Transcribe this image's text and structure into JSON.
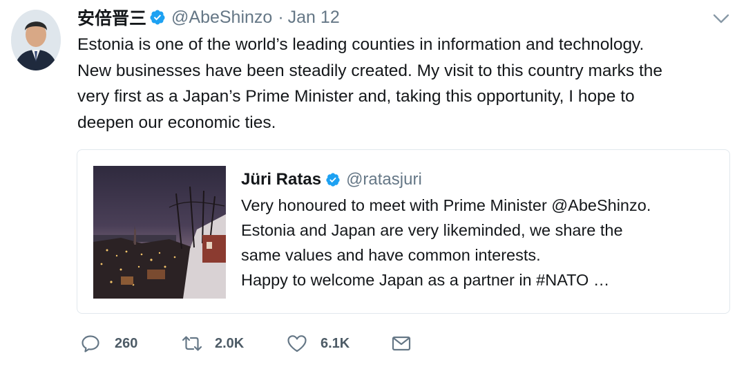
{
  "tweet": {
    "author_name": "安倍晋三",
    "handle": "@AbeShinzo",
    "separator": "·",
    "date": "Jan 12",
    "verified_icon": "verified-badge-icon",
    "text_lines": [
      "Estonia is one of the world’s leading counties in information and technology.",
      "New businesses have been steadily created. My visit to this country marks the",
      "very first as a Japan’s Prime Minister and, taking this opportunity, I hope to",
      "deepen our economic ties."
    ]
  },
  "quoted": {
    "author_name": "Jüri Ratas",
    "handle": "@ratasjuri",
    "text_lines": [
      "Very honoured to meet with Prime Minister @AbeShinzo.",
      "Estonia and Japan are very likeminded, we share the",
      "same values and have common interests.",
      "Happy to welcome Japan as a partner in #NATO …"
    ]
  },
  "actions": {
    "reply_count": "260",
    "retweet_count": "2.0K",
    "like_count": "6.1K"
  },
  "colors": {
    "verified": "#1da1f2",
    "text": "#14171a",
    "muted": "#657786",
    "border": "#e1e8ed"
  }
}
